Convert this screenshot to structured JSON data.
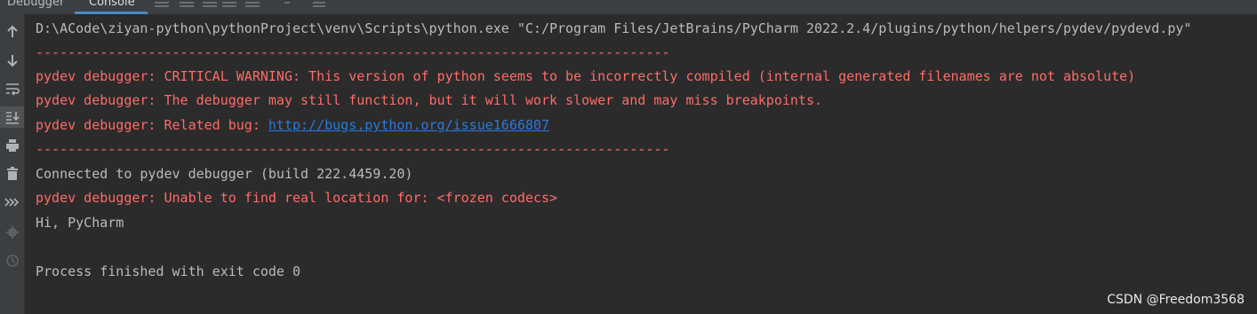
{
  "tabs": {
    "debugger": "Debugger",
    "console": "Console"
  },
  "console": {
    "line1": "D:\\ACode\\ziyan-python\\pythonProject\\venv\\Scripts\\python.exe \"C:/Program Files/JetBrains/PyCharm 2022.2.4/plugins/python/helpers/pydev/pydevd.py\"",
    "separator": "-------------------------------------------------------------------------------",
    "warning": "pydev debugger: CRITICAL WARNING: This version of python seems to be incorrectly compiled (internal generated filenames are not absolute)",
    "still_function": "pydev debugger: The debugger may still function, but it will work slower and may miss breakpoints.",
    "related_bug_prefix": "pydev debugger: Related bug: ",
    "related_bug_link": "http://bugs.python.org/issue1666807",
    "connected": "Connected to pydev debugger (build 222.4459.20)",
    "unable": "pydev debugger: Unable to find real location for: <frozen codecs>",
    "hi": "Hi, PyCharm",
    "process_finished": "Process finished with exit code 0"
  },
  "watermark": "CSDN @Freedom3568",
  "colors": {
    "background": "#2b2b2b",
    "stdout": "#bbbbbb",
    "stderr": "#ff6b68",
    "link": "#287bde"
  },
  "icons": {
    "sidebar": [
      "arrow-up-icon",
      "arrow-down-icon",
      "soft-wrap-icon",
      "scroll-to-end-icon",
      "print-icon",
      "trash-icon",
      "step-over-icon",
      "settings-icon",
      "history-icon"
    ]
  }
}
